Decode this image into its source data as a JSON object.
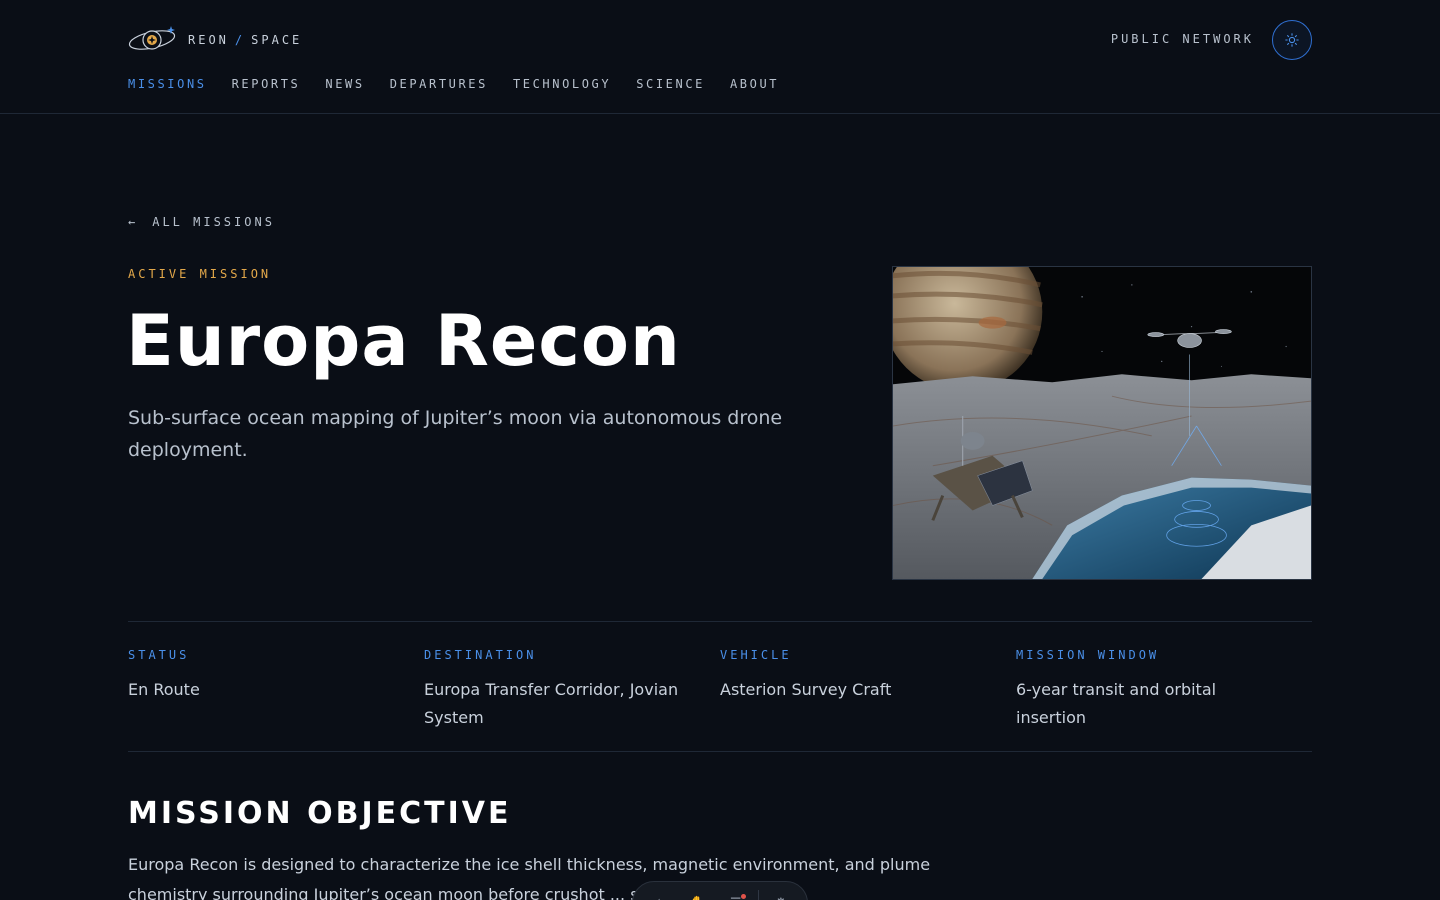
{
  "brand": {
    "name_left": "REON",
    "slash": "/",
    "name_right": "SPACE"
  },
  "header": {
    "network_label": "PUBLIC NETWORK",
    "theme_icon": "sun-icon"
  },
  "nav": {
    "items": [
      {
        "label": "MISSIONS",
        "active": true
      },
      {
        "label": "REPORTS"
      },
      {
        "label": "NEWS"
      },
      {
        "label": "DEPARTURES"
      },
      {
        "label": "TECHNOLOGY"
      },
      {
        "label": "SCIENCE"
      },
      {
        "label": "ABOUT"
      }
    ]
  },
  "hero": {
    "back_arrow": "←",
    "back_label": "ALL MISSIONS",
    "kicker": "ACTIVE MISSION",
    "title": "Europa Recon",
    "subtitle": "Sub-surface ocean mapping of Jupiter’s moon via autonomous drone deployment."
  },
  "facts": [
    {
      "label": "STATUS",
      "value": "En Route"
    },
    {
      "label": "DESTINATION",
      "value": "Europa Transfer Corridor, Jovian System"
    },
    {
      "label": "VEHICLE",
      "value": "Asterion Survey Craft"
    },
    {
      "label": "MISSION WINDOW",
      "value": "6-year transit and orbital insertion"
    }
  ],
  "objective": {
    "title": "MISSION OBJECTIVE",
    "body": "Europa Recon is designed to characterize the ice shell thickness, magnetic environment, and plume chemistry surrounding Jupiter’s ocean moon before crushot ... s are approved"
  },
  "colors": {
    "background": "#0a0e16",
    "accent_blue": "#4a8fe8",
    "accent_amber": "#e3a84a"
  }
}
